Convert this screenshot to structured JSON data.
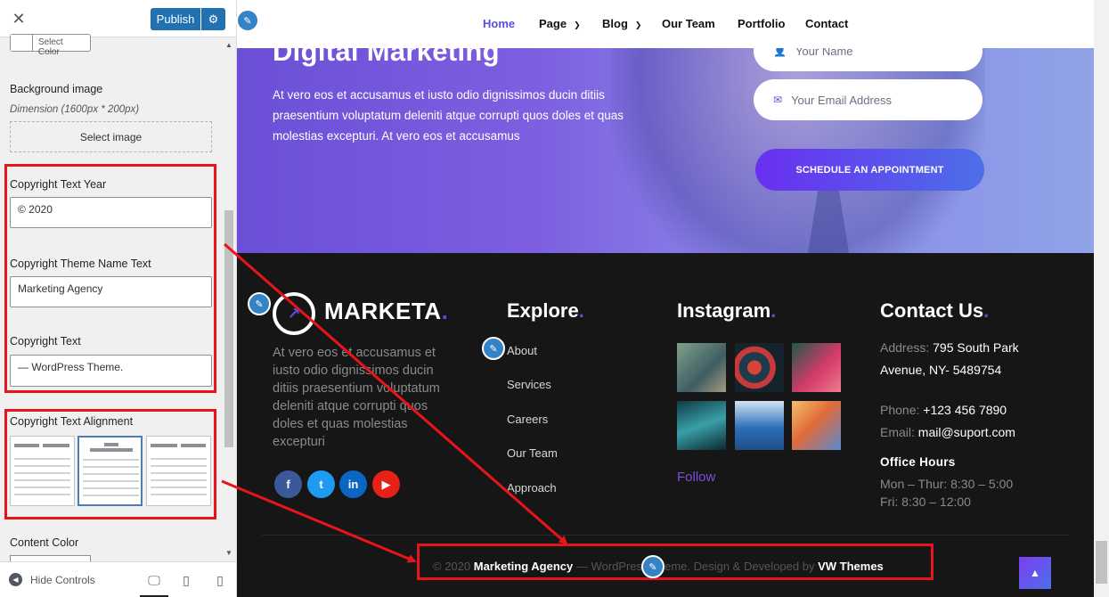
{
  "customizer": {
    "publish_label": "Publish",
    "select_color_label": "Select Color",
    "background_image": {
      "label": "Background image",
      "description": "Dimension (1600px * 200px)",
      "button": "Select image"
    },
    "copyright_year": {
      "label": "Copyright Text Year",
      "value": "© 2020"
    },
    "copyright_theme_name": {
      "label": "Copyright Theme Name Text",
      "value": "Marketing Agency"
    },
    "copyright_text": {
      "label": "Copyright Text",
      "value": "— WordPress Theme."
    },
    "alignment": {
      "label": "Copyright Text Alignment",
      "selected": "center",
      "options": [
        "left",
        "center",
        "right"
      ]
    },
    "content_color_label": "Content Color",
    "hide_controls_label": "Hide Controls",
    "devices": [
      "desktop",
      "tablet",
      "mobile"
    ]
  },
  "preview": {
    "nav": [
      {
        "label": "Home",
        "active": true
      },
      {
        "label": "Page",
        "dropdown": true
      },
      {
        "label": "Blog",
        "dropdown": true
      },
      {
        "label": "Our Team"
      },
      {
        "label": "Portfolio"
      },
      {
        "label": "Contact"
      }
    ],
    "hero": {
      "title": "Digital Marketing",
      "text": "At vero eos et accusamus et iusto odio dignissimos ducin ditiis praesentium voluptatum deleniti atque corrupti quos doles et quas molestias excepturi. At vero eos et accusamus",
      "name_placeholder": "Your Name",
      "email_placeholder": "Your Email Address",
      "cta": "SCHEDULE AN APPOINTMENT"
    },
    "footer": {
      "logo": "MARKETA",
      "about": "At vero eos et accusamus et iusto odio dignissimos ducin ditiis praesentium voluptatum deleniti atque corrupti quos doles et quas molestias excepturi",
      "social": [
        "f",
        "t",
        "in",
        "▶"
      ],
      "explore_title": "Explore",
      "explore_links": [
        "About",
        "Services",
        "Careers",
        "Our Team",
        "Approach"
      ],
      "instagram_title": "Instagram",
      "follow_label": "Follow",
      "contact_title": "Contact Us",
      "address_key": "Address:",
      "address_line1": "795 South Park",
      "address_line2": "Avenue, NY- 5489754",
      "phone_key": "Phone:",
      "phone": "+123 456 7890",
      "email_key": "Email:",
      "email": "mail@suport.com",
      "office_title": "Office Hours",
      "hours_weekday": "Mon – Thur: 8:30 – 5:00",
      "hours_friday": "Fri: 8:30 – 12:00"
    },
    "copyright": {
      "year": "© 2020",
      "theme_name": "Marketing Agency",
      "rest": "— WordPress Theme. Design & Developed by",
      "developer": "VW Themes"
    }
  },
  "colors": {
    "accent": "#5b4fd8",
    "publish": "#2271b1",
    "highlight": "#e8141c",
    "footer_bg": "#161616"
  }
}
